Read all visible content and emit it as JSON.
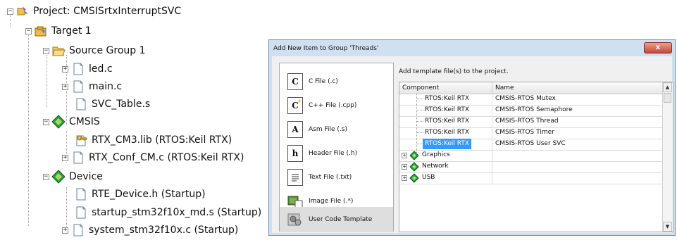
{
  "tree": {
    "project": "Project: CMSISrtxInterruptSVC",
    "target": "Target 1",
    "source_group": "Source Group 1",
    "files": [
      "led.c",
      "main.c",
      "SVC_Table.s"
    ],
    "cmsis": "CMSIS",
    "cmsis_files": [
      "RTX_CM3.lib (RTOS:Keil RTX)",
      "RTX_Conf_CM.c (RTOS:Keil RTX)"
    ],
    "device": "Device",
    "device_files": [
      "RTE_Device.h (Startup)",
      "startup_stm32f10x_md.s (Startup)",
      "system_stm32f10x.c (Startup)"
    ]
  },
  "dialog": {
    "title": "Add New Item to Group 'Threads'",
    "close": "x",
    "hint": "Add template file(s) to the project.",
    "types": [
      {
        "icon": "C",
        "label": "C File (.c)"
      },
      {
        "icon": "C",
        "label": "C++ File (.cpp)"
      },
      {
        "icon": "A",
        "label": "Asm File (.s)"
      },
      {
        "icon": "h",
        "label": "Header File (.h)"
      },
      {
        "icon": "",
        "label": "Text File (.txt)"
      },
      {
        "icon": "",
        "label": "Image File (.*)"
      },
      {
        "icon": "",
        "label": "User Code Template"
      }
    ],
    "columns": [
      "Component",
      "Name"
    ],
    "rows": [
      {
        "component": "RTOS:Keil RTX",
        "name": "CMSIS-RTOS Mutex"
      },
      {
        "component": "RTOS:Keil RTX",
        "name": "CMSIS-RTOS Semaphore"
      },
      {
        "component": "RTOS:Keil RTX",
        "name": "CMSIS-RTOS Thread"
      },
      {
        "component": "RTOS:Keil RTX",
        "name": "CMSIS-RTOS Timer"
      },
      {
        "component": "RTOS:Keil RTX",
        "name": "CMSIS-RTOS User SVC"
      }
    ],
    "groups": [
      "Graphics",
      "Network",
      "USB"
    ]
  }
}
